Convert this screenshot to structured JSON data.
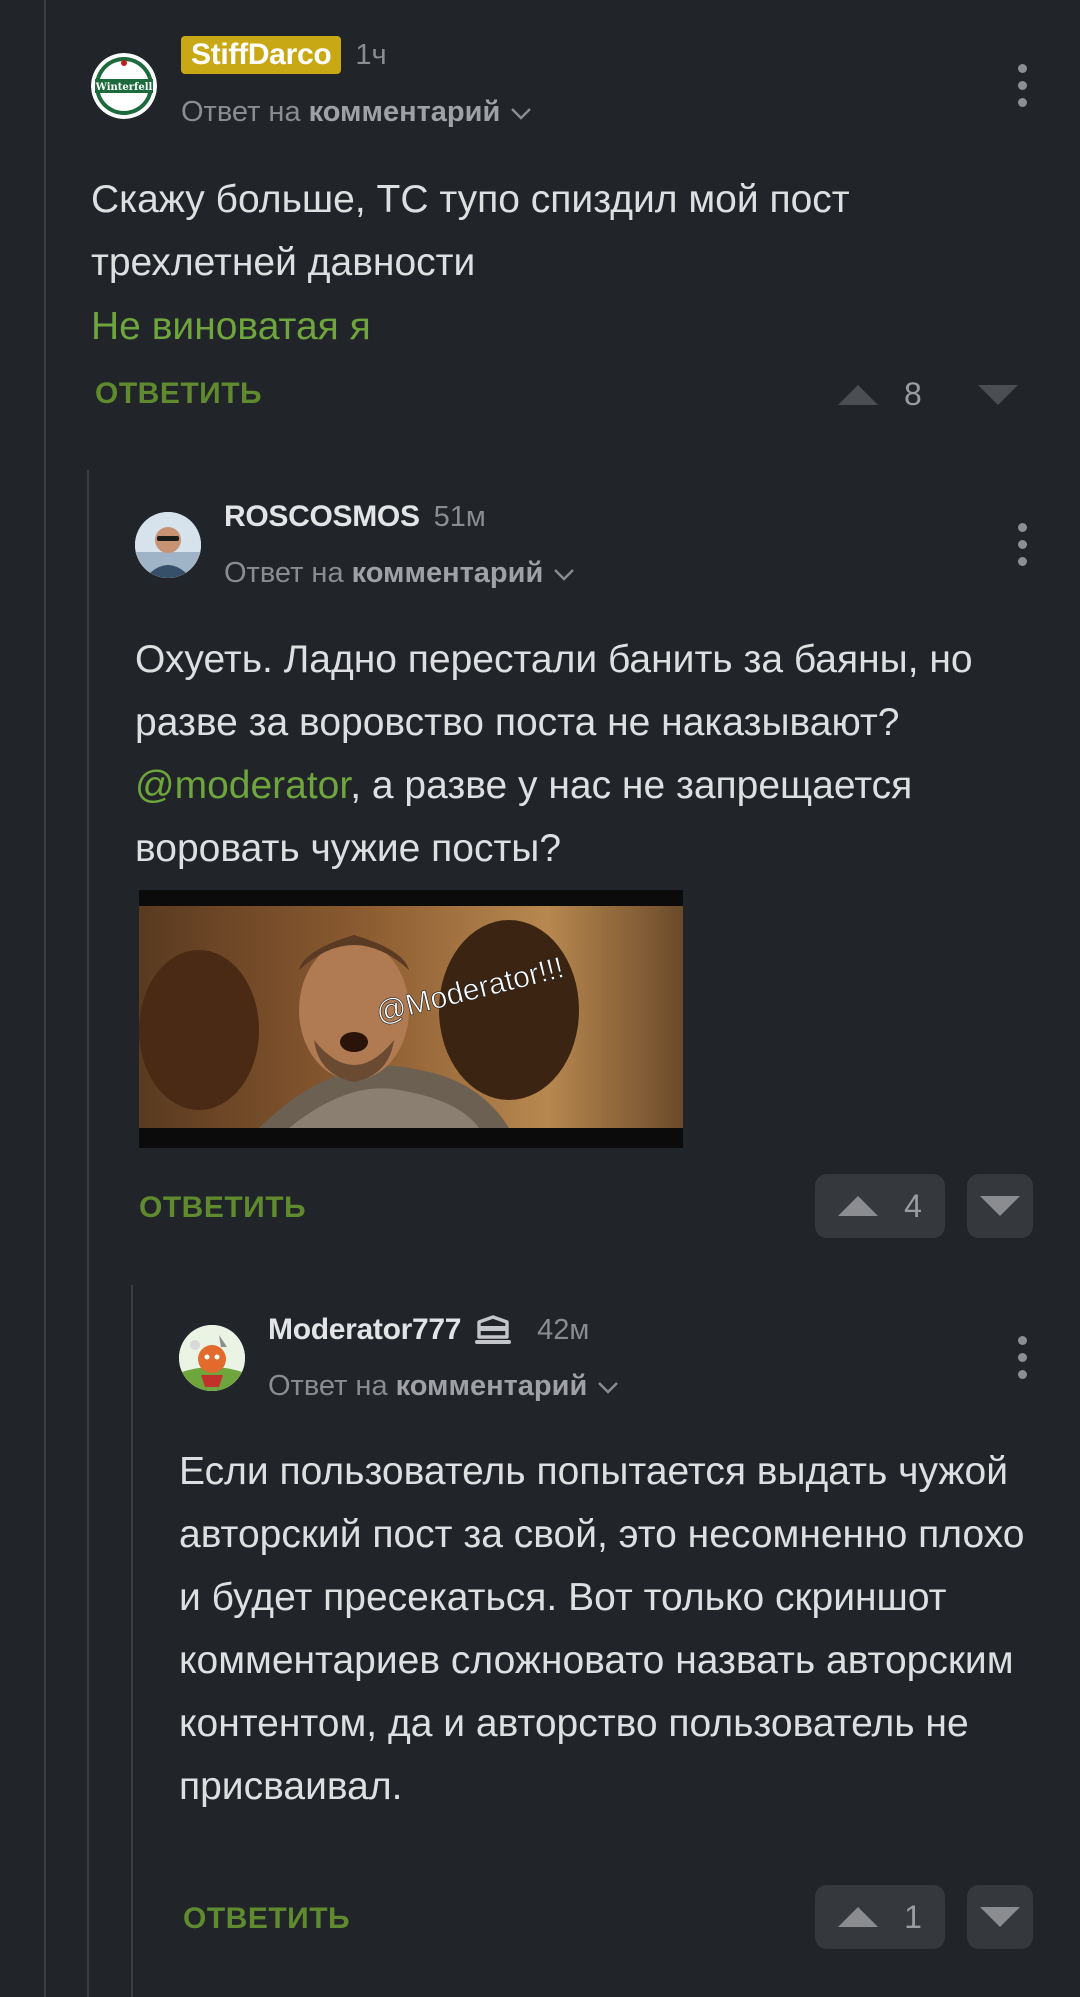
{
  "comments": [
    {
      "author": "StiffDarco",
      "time": "1ч",
      "reply_prefix": "Ответ на",
      "reply_target": "комментарий",
      "text": "Скажу больше, ТС тупо спиздил мой пост трехлетней давности",
      "signature": "Не виноватая я",
      "reply_label": "ОТВЕТИТЬ",
      "votes": "8",
      "avatar_text": "Winterfell"
    },
    {
      "author": "ROSCOSMOS",
      "time": "51м",
      "reply_prefix": "Ответ на",
      "reply_target": "комментарий",
      "text_before": "Охуеть. Ладно перестали банить за баяны, но разве за воровство поста не наказывают? ",
      "mention": "@moderator",
      "text_after": ", а разве у нас не запрещается воровать чужие посты?",
      "image_caption": "@Moderator!!!",
      "reply_label": "ОТВЕТИТЬ",
      "votes": "4"
    },
    {
      "author": "Moderator777",
      "time": "42м",
      "reply_prefix": "Ответ на",
      "reply_target": "комментарий",
      "text": "Если пользователь попытается выдать чужой авторский пост за свой, это несомненно плохо и будет пресекаться. Вот только скриншот комментариев сложновато назвать авторским контентом, да и авторство пользователь не присваивал.",
      "reply_label": "ОТВЕТИТЬ",
      "votes": "1",
      "role_icon": "moderator-badge-icon"
    }
  ],
  "colors": {
    "background": "#212429",
    "accent_green": "#6ea53c",
    "badge_yellow": "#c9a816"
  }
}
